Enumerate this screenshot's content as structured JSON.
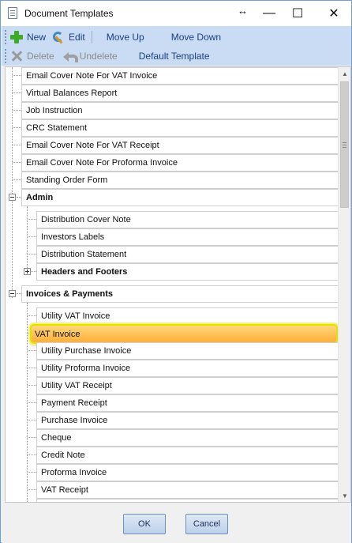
{
  "window": {
    "title": "Document Templates",
    "controls": {
      "resize": "↔",
      "minimize": "—",
      "maximize": "☐",
      "close": "✕"
    }
  },
  "toolbar": {
    "new_label": "New",
    "edit_label": "Edit",
    "move_up_label": "Move Up",
    "move_down_label": "Move Down",
    "delete_label": "Delete",
    "undelete_label": "Undelete",
    "default_template_label": "Default Template"
  },
  "tree": {
    "top_items": [
      "Email Cover Note For VAT Invoice",
      "Virtual Balances Report",
      "Job Instruction",
      "CRC Statement",
      "Email Cover Note For VAT Receipt",
      "Email Cover Note For Proforma Invoice",
      "Standing Order Form"
    ],
    "admin": {
      "label": "Admin",
      "items": [
        "Distribution Cover Note",
        "Investors Labels",
        "Distribution Statement"
      ],
      "subgroup_label": "Headers and Footers"
    },
    "invoices": {
      "label": "Invoices & Payments",
      "items": [
        "Utility VAT Invoice",
        "VAT Invoice",
        "Utility Purchase Invoice",
        "Utility Proforma Invoice",
        "Utility VAT Receipt",
        "Payment Receipt",
        "Purchase Invoice",
        "Cheque",
        "Credit Note",
        "Proforma Invoice",
        "VAT Receipt"
      ],
      "selected_item": "VAT Invoice"
    }
  },
  "footer": {
    "ok_label": "OK",
    "cancel_label": "Cancel"
  },
  "colors": {
    "toolbar_bg": "#c9dcf3",
    "selection_gradient_top": "#ffd77a",
    "selection_gradient_bottom": "#ffb038",
    "selection_border": "#e3e100",
    "add_icon": "#3faa2a"
  }
}
